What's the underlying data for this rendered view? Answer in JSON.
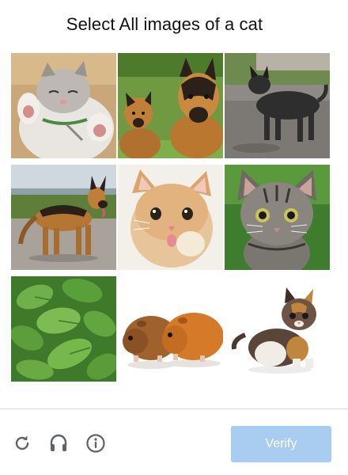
{
  "challenge": {
    "title": "Select All images of a cat",
    "tiles": [
      {
        "subject": "kitten-on-back"
      },
      {
        "subject": "german-shepherd-with-puppy"
      },
      {
        "subject": "black-dog-on-dirt"
      },
      {
        "subject": "german-shepherd-standing"
      },
      {
        "subject": "orange-kitten"
      },
      {
        "subject": "tabby-kitten-on-grass"
      },
      {
        "subject": "green-leaves"
      },
      {
        "subject": "two-guinea-pigs"
      },
      {
        "subject": "calico-kitten"
      }
    ]
  },
  "footer": {
    "reload_icon": "reload-icon",
    "audio_icon": "headphones-icon",
    "info_icon": "info-icon",
    "verify_label": "Verify",
    "verify_color": "#a9cdf0"
  }
}
